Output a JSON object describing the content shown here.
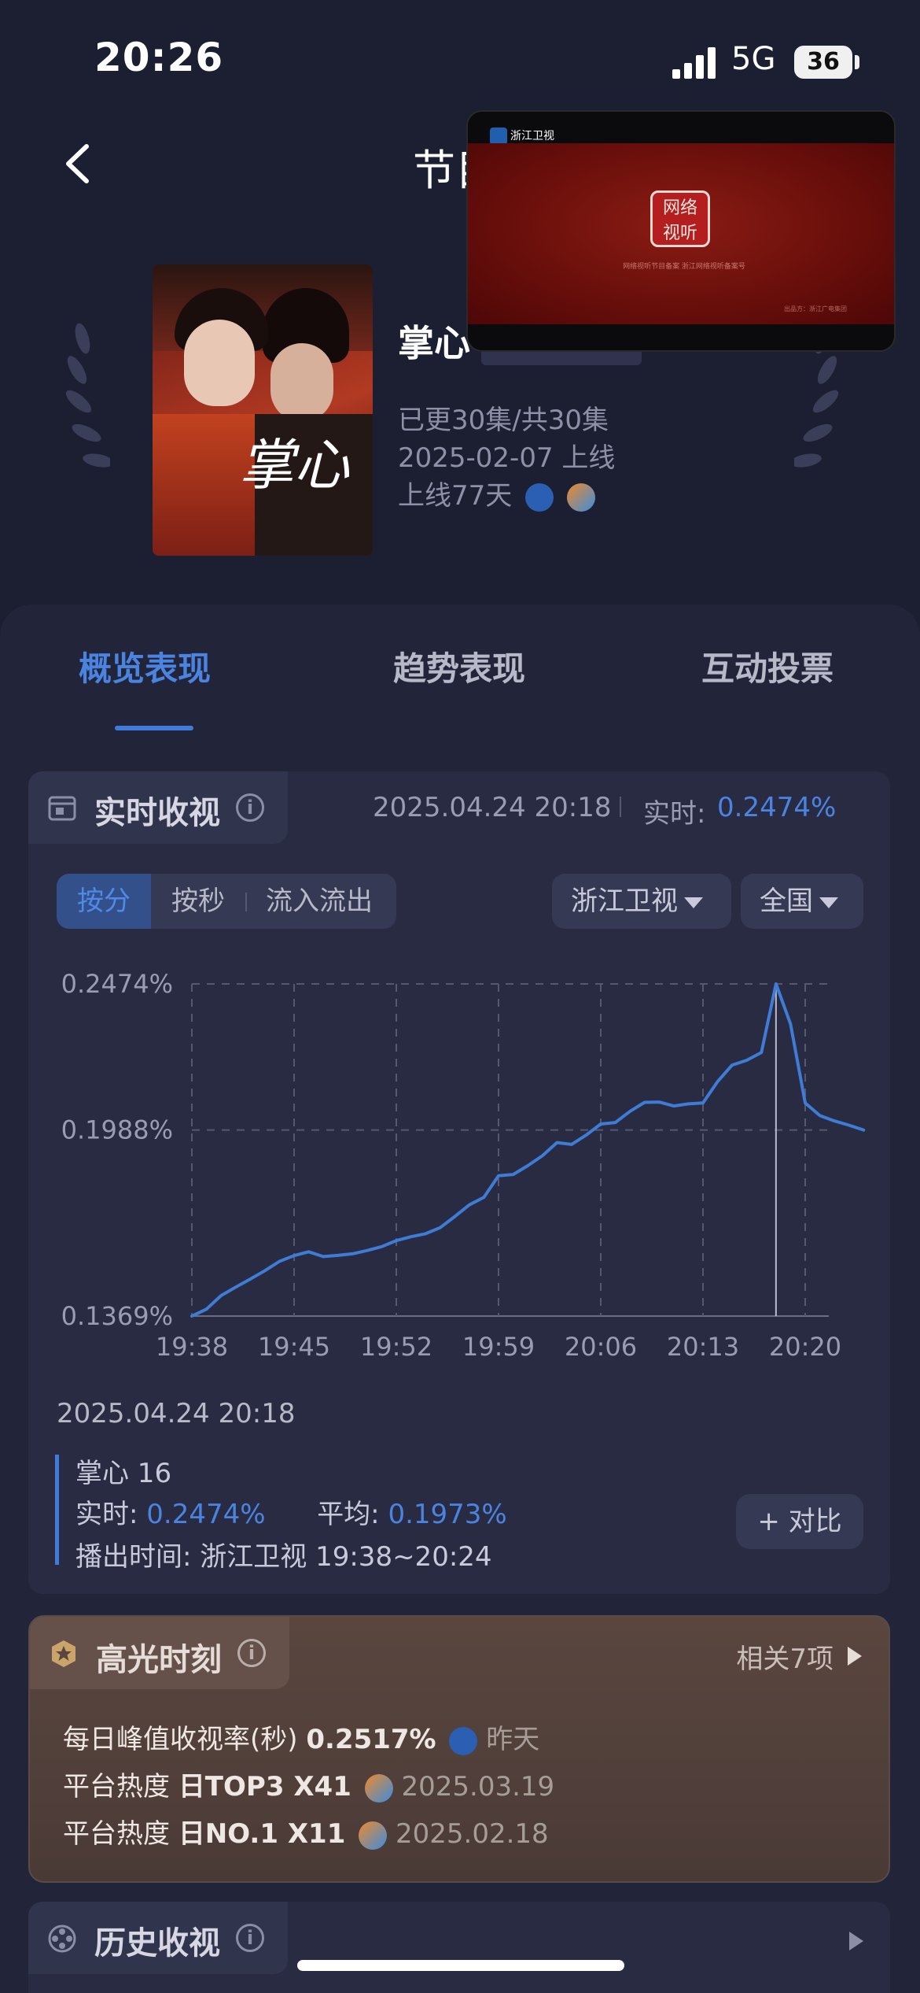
{
  "status_bar": {
    "time": "20:26",
    "network": "5G",
    "battery": "36"
  },
  "header": {
    "title": "节目"
  },
  "video_overlay": {
    "channel": "浙江卫视",
    "seal_text": [
      "网络",
      "视听"
    ],
    "seal_caption": "网络视听节目备案\n浙江网络视听备案号",
    "footer": "出品方：浙江广电集团"
  },
  "show": {
    "name": "掌心",
    "episodes": "已更30集/共30集",
    "release": "2025-02-07 上线",
    "days_online": "上线77天",
    "poster_calligraphy": "掌心"
  },
  "tabs": [
    {
      "label": "概览表现",
      "active": true
    },
    {
      "label": "趋势表现",
      "active": false
    },
    {
      "label": "互动投票",
      "active": false
    }
  ],
  "realtime": {
    "title": "实时收视",
    "timestamp": "2025.04.24 20:18",
    "label": "实时:",
    "value": "0.2474%",
    "segments": [
      "按分",
      "按秒",
      "流入流出"
    ],
    "selected_segment": "按分",
    "channel_dropdown": "浙江卫视",
    "region_dropdown": "全国"
  },
  "chart_data": {
    "type": "line",
    "x_ticks": [
      "19:38",
      "19:45",
      "19:52",
      "19:59",
      "20:06",
      "20:13",
      "20:20"
    ],
    "y_ticks": [
      "0.2474%",
      "0.1988%",
      "0.1369%"
    ],
    "ylim": [
      0.1369,
      0.2474
    ],
    "cursor_x": "20:18",
    "grid": true,
    "series": [
      {
        "color": "#3f7cd6",
        "x": [
          "19:38",
          "19:39",
          "19:40",
          "19:41",
          "19:42",
          "19:43",
          "19:44",
          "19:45",
          "19:46",
          "19:47",
          "19:48",
          "19:49",
          "19:50",
          "19:51",
          "19:52",
          "19:53",
          "19:54",
          "19:55",
          "19:56",
          "19:57",
          "19:58",
          "19:59",
          "20:00",
          "20:01",
          "20:02",
          "20:03",
          "20:04",
          "20:05",
          "20:06",
          "20:07",
          "20:08",
          "20:09",
          "20:10",
          "20:11",
          "20:12",
          "20:13",
          "20:14",
          "20:15",
          "20:16",
          "20:17",
          "20:18",
          "20:19",
          "20:20",
          "20:21",
          "20:22",
          "20:23",
          "20:24"
        ],
        "values": [
          0.1369,
          0.1392,
          0.1437,
          0.1465,
          0.1492,
          0.152,
          0.1551,
          0.157,
          0.1583,
          0.1567,
          0.1571,
          0.1576,
          0.1587,
          0.16,
          0.162,
          0.1633,
          0.1643,
          0.1663,
          0.17,
          0.1739,
          0.1764,
          0.1836,
          0.184,
          0.1869,
          0.1902,
          0.1946,
          0.194,
          0.1971,
          0.2008,
          0.2013,
          0.205,
          0.208,
          0.2081,
          0.2068,
          0.2075,
          0.2078,
          0.2149,
          0.2204,
          0.222,
          0.2246,
          0.2474,
          0.234,
          0.2078,
          0.2036,
          0.2018,
          0.2004,
          0.1988
        ]
      }
    ]
  },
  "detail": {
    "timestamp": "2025.04.24 20:18",
    "episode": "掌心 16",
    "realtime_label": "实时:",
    "realtime_value": "0.2474%",
    "average_label": "平均:",
    "average_value": "0.1973%",
    "airtime_label": "播出时间:",
    "airtime_value": "浙江卫视 19:38~20:24",
    "compare_button": "+ 对比"
  },
  "highlights": {
    "title": "高光时刻",
    "related": "相关7项",
    "rows": [
      {
        "label": "每日峰值收视率(秒)",
        "value": "0.2517%",
        "date": "昨天"
      },
      {
        "label": "平台热度",
        "value": "日TOP3 X41",
        "date": "2025.03.19"
      },
      {
        "label": "平台热度",
        "value": "日NO.1 X11",
        "date": "2025.02.18"
      }
    ]
  },
  "history": {
    "title": "历史收视"
  }
}
